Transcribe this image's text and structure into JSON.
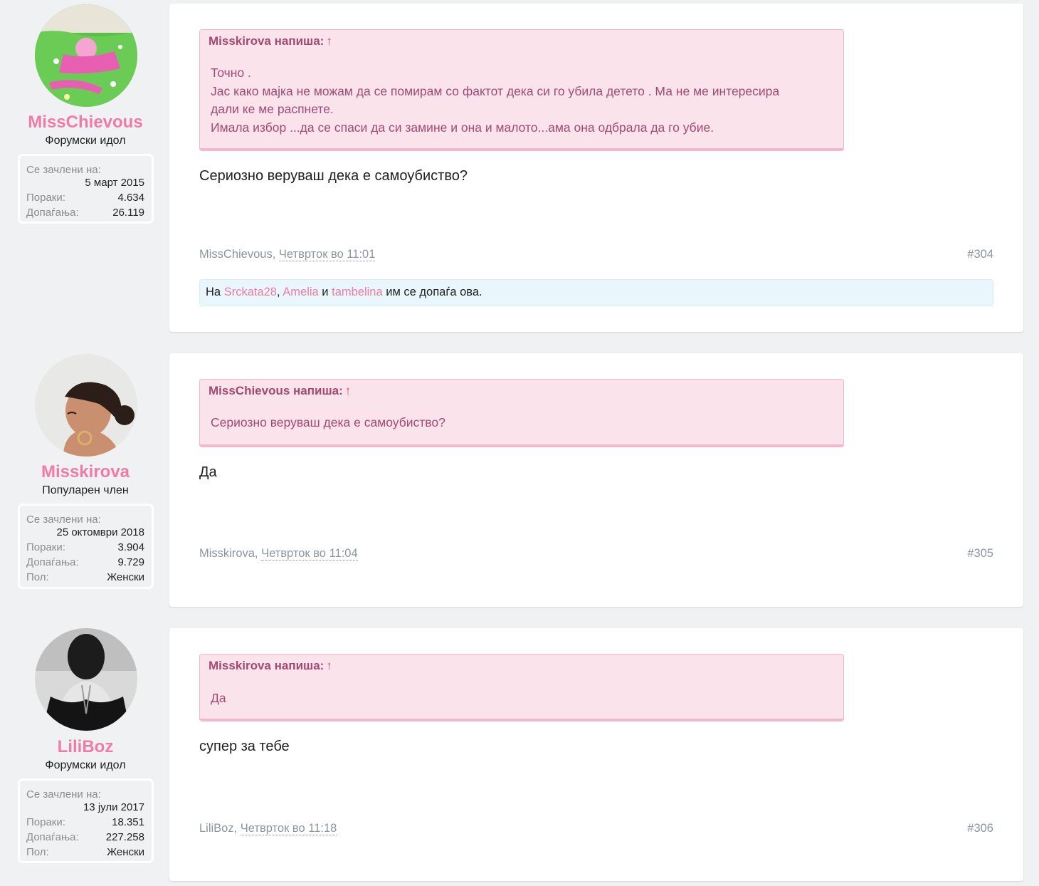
{
  "posts": [
    {
      "user": {
        "name": "MissChievous",
        "title": "Форумски идол",
        "joined_label": "Се зачлени на:",
        "joined": "5 март 2015",
        "messages_label": "Пораки:",
        "messages": "4.634",
        "likes_label": "Допаѓања:",
        "likes": "26.119"
      },
      "quote": {
        "author": "Misskirova напиша:",
        "arrow": "↑",
        "lines": [
          "Точно .",
          "Јас како мајка не можам да се помирам со фактот дека си го убила детето . Ма не ме интересира",
          "дали ке ме распнете.",
          "Имала избор ...да се спаси да си замине и она и малото...ама она одбрала да го убие."
        ]
      },
      "message": "Сериозно веруваш дека е самоубиство?",
      "meta_author": "MissChievous,",
      "meta_date": "Четврток во 11:01",
      "permalink": "#304",
      "liked_by": {
        "prefix": "На",
        "users": [
          "Srckata28",
          "Amelia",
          "tambelina"
        ],
        "sep": ",",
        "and": "и",
        "suffix": "им се допаѓа ова."
      }
    },
    {
      "user": {
        "name": "Misskirova",
        "title": "Популарен член",
        "joined_label": "Се зачлени на:",
        "joined": "25 октомври 2018",
        "messages_label": "Пораки:",
        "messages": "3.904",
        "likes_label": "Допаѓања:",
        "likes": "9.729",
        "gender_label": "Пол:",
        "gender": "Женски"
      },
      "quote": {
        "author": "MissChievous напиша:",
        "arrow": "↑",
        "lines": [
          "Сериозно веруваш дека е самоубиство?"
        ]
      },
      "message": "Да",
      "meta_author": "Misskirova,",
      "meta_date": "Четврток во 11:04",
      "permalink": "#305"
    },
    {
      "user": {
        "name": "LiliBoz",
        "title": "Форумски идол",
        "joined_label": "Се зачлени на:",
        "joined": "13 јули 2017",
        "messages_label": "Пораки:",
        "messages": "18.351",
        "likes_label": "Допаѓања:",
        "likes": "227.258",
        "gender_label": "Пол:",
        "gender": "Женски"
      },
      "quote": {
        "author": "Misskirova напиша:",
        "arrow": "↑",
        "lines": [
          "Да"
        ]
      },
      "message": "супер за тебе",
      "meta_author": "LiliBoz,",
      "meta_date": "Четврток во 11:18",
      "permalink": "#306"
    }
  ],
  "colors": {
    "accent": "#f07ba5",
    "quote_bg": "#fbe3ec",
    "quote_text": "#a24a73",
    "likes_bg": "#e9f6fc",
    "page_bg": "#f0f1f3"
  }
}
